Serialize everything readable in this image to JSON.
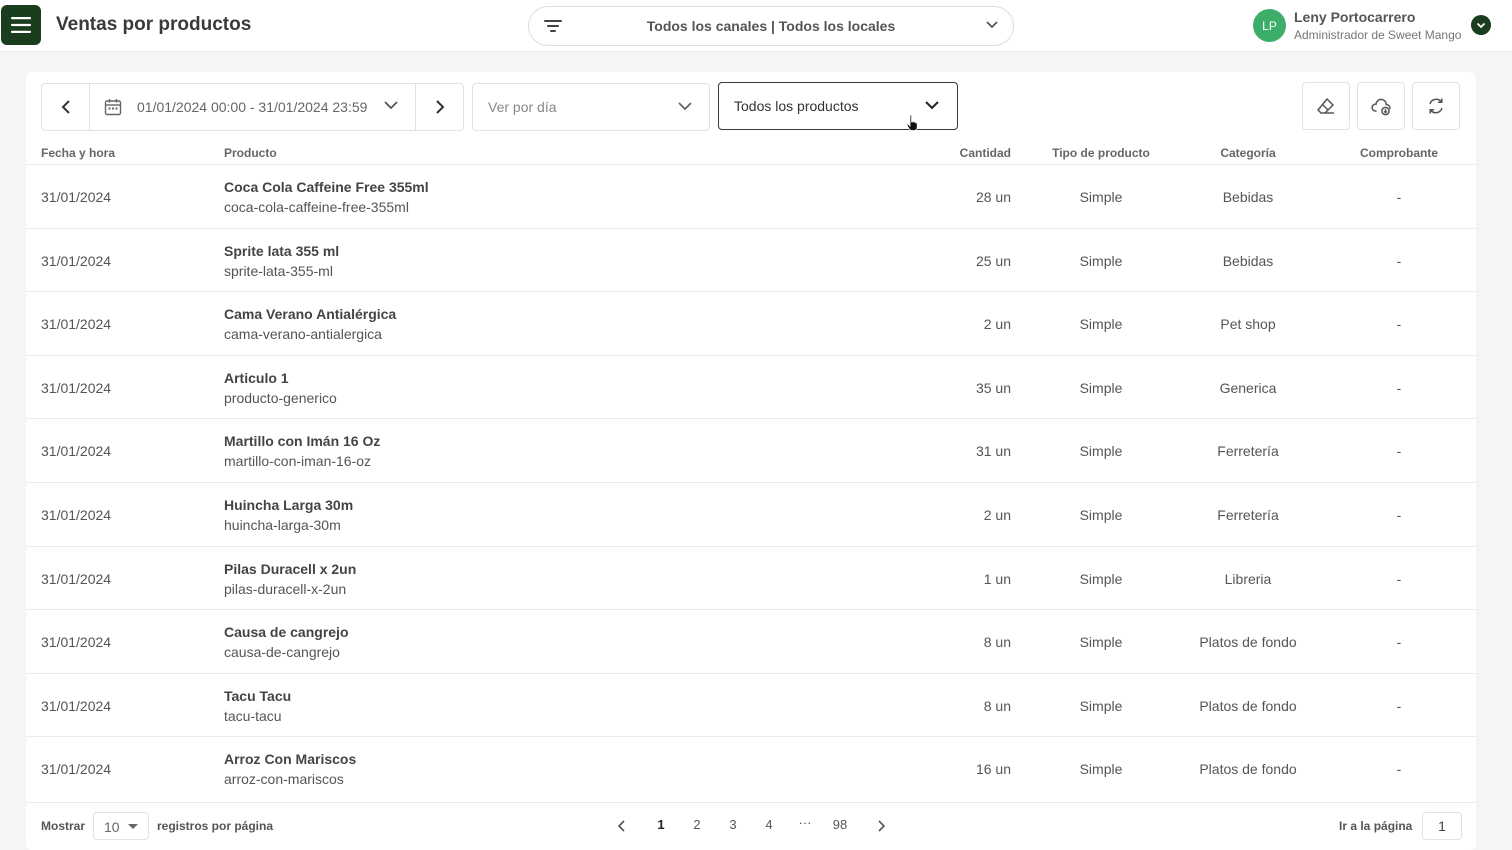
{
  "header": {
    "title": "Ventas por productos",
    "channel_filter": "Todos los canales | Todos los locales",
    "user": {
      "initials": "LP",
      "name": "Leny Portocarrero",
      "role": "Administrador de Sweet Mango"
    }
  },
  "filters": {
    "date_range": "01/01/2024 00:00 - 31/01/2024 23:59",
    "view_placeholder": "Ver por día",
    "product_filter": "Todos los productos"
  },
  "table": {
    "columns": [
      "Fecha y hora",
      "Producto",
      "Cantidad",
      "Tipo de producto",
      "Categoría",
      "Comprobante"
    ],
    "rows": [
      {
        "date": "31/01/2024",
        "name": "Coca Cola Caffeine Free 355ml",
        "slug": "coca-cola-caffeine-free-355ml",
        "qty": "28 un",
        "type": "Simple",
        "category": "Bebidas",
        "receipt": "-"
      },
      {
        "date": "31/01/2024",
        "name": "Sprite lata 355 ml",
        "slug": "sprite-lata-355-ml",
        "qty": "25 un",
        "type": "Simple",
        "category": "Bebidas",
        "receipt": "-"
      },
      {
        "date": "31/01/2024",
        "name": "Cama Verano Antialérgica",
        "slug": "cama-verano-antialergica",
        "qty": "2 un",
        "type": "Simple",
        "category": "Pet shop",
        "receipt": "-"
      },
      {
        "date": "31/01/2024",
        "name": "Articulo 1",
        "slug": "producto-generico",
        "qty": "35 un",
        "type": "Simple",
        "category": "Generica",
        "receipt": "-"
      },
      {
        "date": "31/01/2024",
        "name": "Martillo con Imán 16 Oz",
        "slug": "martillo-con-iman-16-oz",
        "qty": "31 un",
        "type": "Simple",
        "category": "Ferretería",
        "receipt": "-"
      },
      {
        "date": "31/01/2024",
        "name": "Huincha Larga 30m",
        "slug": "huincha-larga-30m",
        "qty": "2 un",
        "type": "Simple",
        "category": "Ferretería",
        "receipt": "-"
      },
      {
        "date": "31/01/2024",
        "name": "Pilas Duracell x 2un",
        "slug": "pilas-duracell-x-2un",
        "qty": "1 un",
        "type": "Simple",
        "category": "Libreria",
        "receipt": "-"
      },
      {
        "date": "31/01/2024",
        "name": "Causa de cangrejo",
        "slug": "causa-de-cangrejo",
        "qty": "8 un",
        "type": "Simple",
        "category": "Platos de fondo",
        "receipt": "-"
      },
      {
        "date": "31/01/2024",
        "name": "Tacu Tacu",
        "slug": "tacu-tacu",
        "qty": "8 un",
        "type": "Simple",
        "category": "Platos de fondo",
        "receipt": "-"
      },
      {
        "date": "31/01/2024",
        "name": "Arroz Con Mariscos",
        "slug": "arroz-con-mariscos",
        "qty": "16 un",
        "type": "Simple",
        "category": "Platos de fondo",
        "receipt": "-"
      }
    ]
  },
  "footer": {
    "show_label": "Mostrar",
    "page_size": "10",
    "per_page_label": "registros por página",
    "pages": [
      "1",
      "2",
      "3",
      "4",
      "···",
      "98"
    ],
    "current_page": "1",
    "goto_label": "Ir a la página",
    "goto_value": "1"
  },
  "colors": {
    "brand": "#1a3d1d",
    "avatar": "#3dae6a"
  }
}
